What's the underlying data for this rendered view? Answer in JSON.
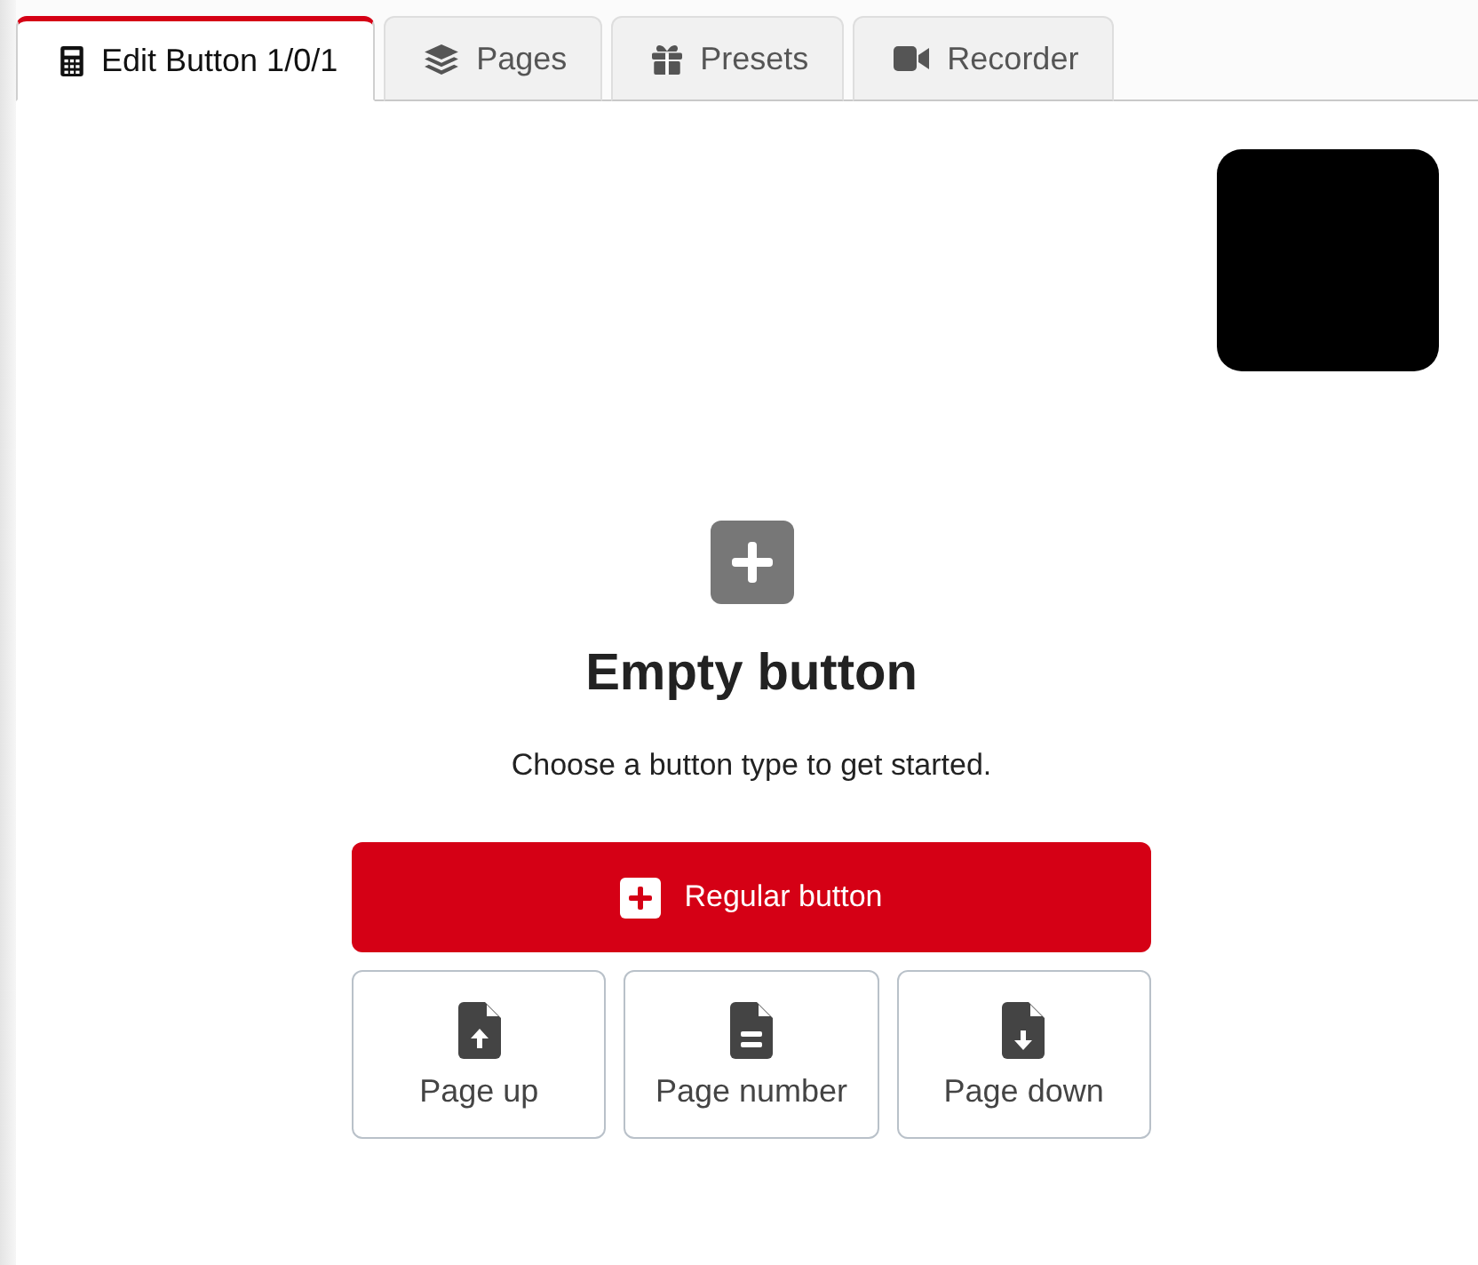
{
  "tabs": [
    {
      "label": "Edit Button 1/0/1",
      "selected": true
    },
    {
      "label": "Pages",
      "selected": false
    },
    {
      "label": "Presets",
      "selected": false
    },
    {
      "label": "Recorder",
      "selected": false
    }
  ],
  "empty_state": {
    "title": "Empty button",
    "description": "Choose a button type to get started."
  },
  "primary_action": {
    "label": "Regular button"
  },
  "button_types": [
    {
      "label": "Page up"
    },
    {
      "label": "Page number"
    },
    {
      "label": "Page down"
    }
  ]
}
